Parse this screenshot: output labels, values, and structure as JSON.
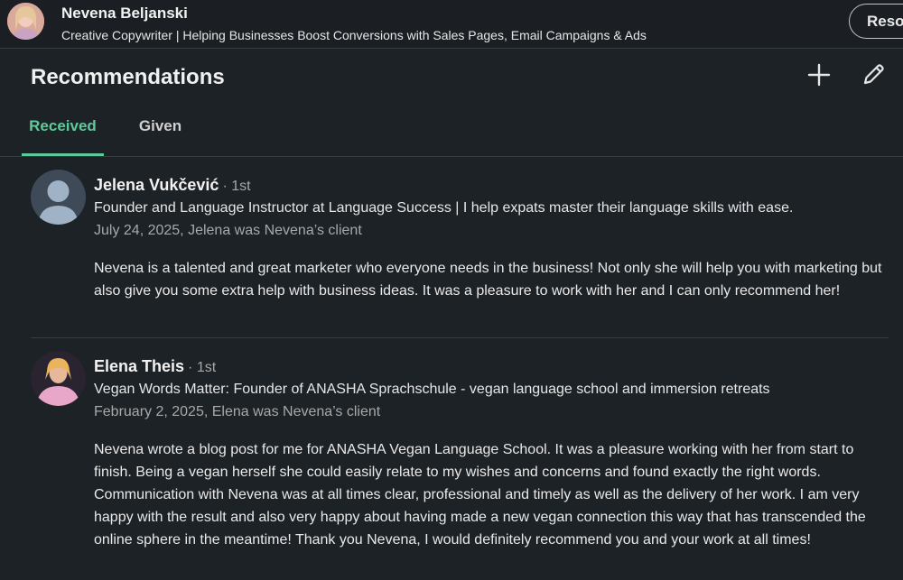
{
  "profile": {
    "name": "Nevena Beljanski",
    "headline": "Creative Copywriter | Helping Businesses Boost Conversions with Sales Pages, Email Campaigns & Ads",
    "resources_label": "Reso"
  },
  "section": {
    "title": "Recommendations",
    "add_icon": "plus-icon",
    "edit_icon": "pencil-icon"
  },
  "tabs": [
    {
      "label": "Received",
      "active": true
    },
    {
      "label": "Given",
      "active": false
    }
  ],
  "recommendations": [
    {
      "name": "Jelena Vukčević",
      "degree": "· 1st",
      "headline": "Founder and Language Instructor at Language Success | I help expats master their language skills with ease.",
      "meta": "July 24, 2025, Jelena was Nevena’s client",
      "text": "Nevena is a talented and great marketer who everyone needs in the business! Not only she will help you with marketing but also give you some extra help with business ideas. It was a pleasure to work with her and I can only recommend her!"
    },
    {
      "name": "Elena Theis",
      "degree": "· 1st",
      "headline": "Vegan Words Matter: Founder of ANASHA Sprachschule - vegan language school and immersion retreats",
      "meta": "February 2, 2025, Elena was Nevena’s client",
      "text": "Nevena wrote a blog post for me for ANASHA Vegan Language School. It was a pleasure working with her from start to finish. Being a vegan herself she could easily relate to my wishes and concerns and found exactly the right words. Communication with Nevena was at all times clear, professional and timely as well as the delivery of her work. I am very happy with the result and also very happy about having made a new vegan connection this way that has transcended the online sphere in the meantime! Thank you Nevena, I would definitely recommend you and your work at all times!"
    }
  ]
}
